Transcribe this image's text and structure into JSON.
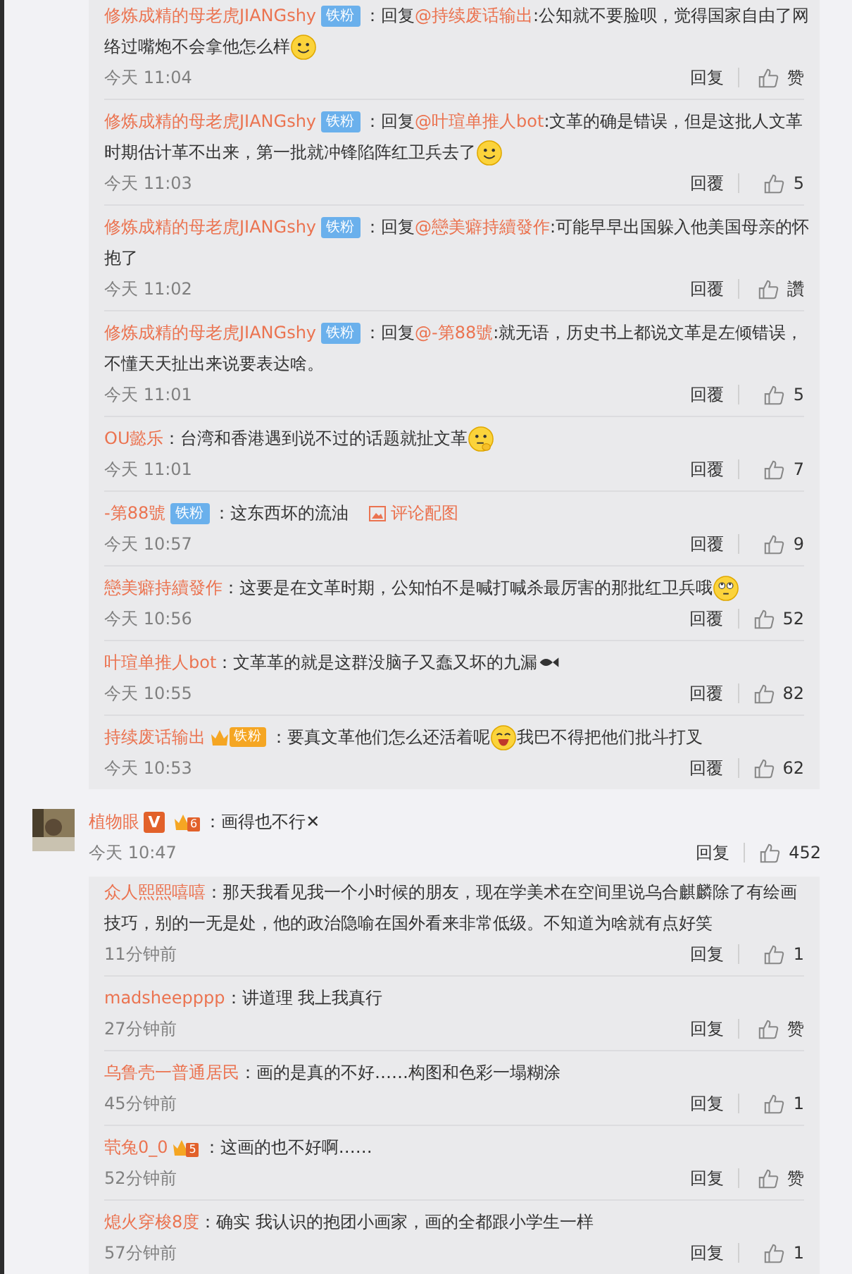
{
  "thread": {
    "replies": [
      {
        "user": "修炼成精的母老虎JIANGshy",
        "badges": [
          {
            "kind": "fan",
            "text": "铁粉"
          }
        ],
        "colon": "：",
        "lines": [
          [
            {
              "kind": "text",
              "text": "回复"
            },
            {
              "kind": "mention",
              "text": "@持续废话输出"
            },
            {
              "kind": "text",
              "text": ":公知就不要脸呗，觉得国家自由了网"
            }
          ],
          [
            {
              "kind": "text",
              "text": "络过嘴炮不会拿他怎么样"
            },
            {
              "kind": "smile_emoji"
            }
          ]
        ],
        "time": "今天 11:04",
        "reply": "回复",
        "likes": "赞"
      },
      {
        "user": "修炼成精的母老虎JIANGshy",
        "badges": [
          {
            "kind": "fan",
            "text": "铁粉"
          }
        ],
        "colon": "：",
        "lines": [
          [
            {
              "kind": "text",
              "text": "回复"
            },
            {
              "kind": "mention",
              "text": "@叶瑄单推人bot"
            },
            {
              "kind": "text",
              "text": ":文革的确是错误，但是这批人文革"
            }
          ],
          [
            {
              "kind": "text",
              "text": "时期估计革不出来，第一批就冲锋陷阵红卫兵去了"
            },
            {
              "kind": "smile_emoji"
            }
          ]
        ],
        "time": "今天 11:03",
        "reply": "回覆",
        "likes": "5"
      },
      {
        "user": "修炼成精的母老虎JIANGshy",
        "badges": [
          {
            "kind": "fan",
            "text": "铁粉"
          }
        ],
        "colon": "：",
        "lines": [
          [
            {
              "kind": "text",
              "text": "回复"
            },
            {
              "kind": "mention",
              "text": "@戀美癖持續發作"
            },
            {
              "kind": "text",
              "text": ":可能早早出国躲入他美国母亲的怀"
            }
          ],
          [
            {
              "kind": "text",
              "text": "抱了"
            }
          ]
        ],
        "time": "今天 11:02",
        "reply": "回覆",
        "likes": "讚"
      },
      {
        "user": "修炼成精的母老虎JIANGshy",
        "badges": [
          {
            "kind": "fan",
            "text": "铁粉"
          }
        ],
        "colon": "：",
        "lines": [
          [
            {
              "kind": "text",
              "text": "回复"
            },
            {
              "kind": "mention",
              "text": "@-第88號"
            },
            {
              "kind": "text",
              "text": ":就无语，历史书上都说文革是左倾错误，"
            }
          ],
          [
            {
              "kind": "text",
              "text": "不懂天天扯出来说要表达啥。"
            }
          ]
        ],
        "time": "今天 11:01",
        "reply": "回覆",
        "likes": "5"
      },
      {
        "user": "OU懿乐",
        "colon": "：",
        "lines": [
          [
            {
              "kind": "text",
              "text": "台湾和香港遇到说不过的话题就扯文革"
            },
            {
              "kind": "think_emoji"
            }
          ]
        ],
        "time": "今天 11:01",
        "reply": "回覆",
        "likes": "7"
      },
      {
        "user": "-第88號",
        "badges": [
          {
            "kind": "fan",
            "text": "铁粉"
          }
        ],
        "colon": "：",
        "lines": [
          [
            {
              "kind": "text",
              "text": "这东西坏的流油"
            },
            {
              "kind": "image_link",
              "text": "评论配图"
            }
          ]
        ],
        "time": "今天 10:57",
        "reply": "回覆",
        "likes": "9"
      },
      {
        "user": "戀美癖持續發作",
        "colon": "：",
        "lines": [
          [
            {
              "kind": "text",
              "text": "这要是在文革时期，公知怕不是喊打喊杀最厉害的那批红卫兵哦"
            },
            {
              "kind": "rolleyes_emoji"
            }
          ]
        ],
        "time": "今天 10:56",
        "reply": "回覆",
        "likes": "52"
      },
      {
        "user": "叶瑄单推人bot",
        "colon": "：",
        "lines": [
          [
            {
              "kind": "text",
              "text": "文革革的就是这群没脑子又蠢又坏的九漏"
            },
            {
              "kind": "fish_emoji"
            }
          ]
        ],
        "time": "今天 10:55",
        "reply": "回覆",
        "likes": "82"
      },
      {
        "user": "持续废话输出",
        "badges": [
          {
            "kind": "crown_fan",
            "text": "铁粉"
          }
        ],
        "colon": "：",
        "lines": [
          [
            {
              "kind": "text",
              "text": "要真文革他们怎么还活着呢"
            },
            {
              "kind": "laugh_emoji"
            },
            {
              "kind": "text",
              "text": "我巴不得把他们批斗打叉"
            }
          ]
        ],
        "time": "今天 10:53",
        "reply": "回覆",
        "likes": "62"
      }
    ]
  },
  "comment": {
    "user": "植物眼",
    "badges": [
      {
        "kind": "verified",
        "text": "V"
      },
      {
        "kind": "crown",
        "text": "6"
      }
    ],
    "colon": "：",
    "lines": [
      [
        {
          "kind": "text",
          "text": "画得也不行✕"
        }
      ]
    ],
    "time": "今天 10:47",
    "reply": "回复",
    "likes": "452",
    "replies": [
      {
        "user": "众人熙熙嘻嘻",
        "colon": "：",
        "lines": [
          [
            {
              "kind": "text",
              "text": "那天我看见我一个小时候的朋友，现在学美术在空间里说乌合麒麟除了有绘画"
            }
          ],
          [
            {
              "kind": "text",
              "text": "技巧，别的一无是处，他的政治隐喻在国外看来非常低级。不知道为啥就有点好笑"
            }
          ]
        ],
        "time": "11分钟前",
        "reply": "回复",
        "likes": "1"
      },
      {
        "user": "madsheepppp",
        "colon": "：",
        "lines": [
          [
            {
              "kind": "text",
              "text": "讲道理  我上我真行"
            }
          ]
        ],
        "time": "27分钟前",
        "reply": "回复",
        "likes": "赞"
      },
      {
        "user": "乌鲁壳一普通居民",
        "colon": "：",
        "lines": [
          [
            {
              "kind": "text",
              "text": "画的是真的不好……构图和色彩一塌糊涂"
            }
          ]
        ],
        "time": "45分钟前",
        "reply": "回复",
        "likes": "1"
      },
      {
        "user": "茕兔0_0",
        "badges": [
          {
            "kind": "crown",
            "text": "5"
          }
        ],
        "colon": "：",
        "lines": [
          [
            {
              "kind": "text",
              "text": "这画的也不好啊……"
            }
          ]
        ],
        "time": "52分钟前",
        "reply": "回复",
        "likes": "赞"
      },
      {
        "user": "熄火穿梭8度",
        "colon": "：",
        "lines": [
          [
            {
              "kind": "text",
              "text": "确实 我认识的抱团小画家，画的全都跟小学生一样"
            }
          ]
        ],
        "time": "57分钟前",
        "reply": "回复",
        "likes": "1"
      }
    ]
  }
}
